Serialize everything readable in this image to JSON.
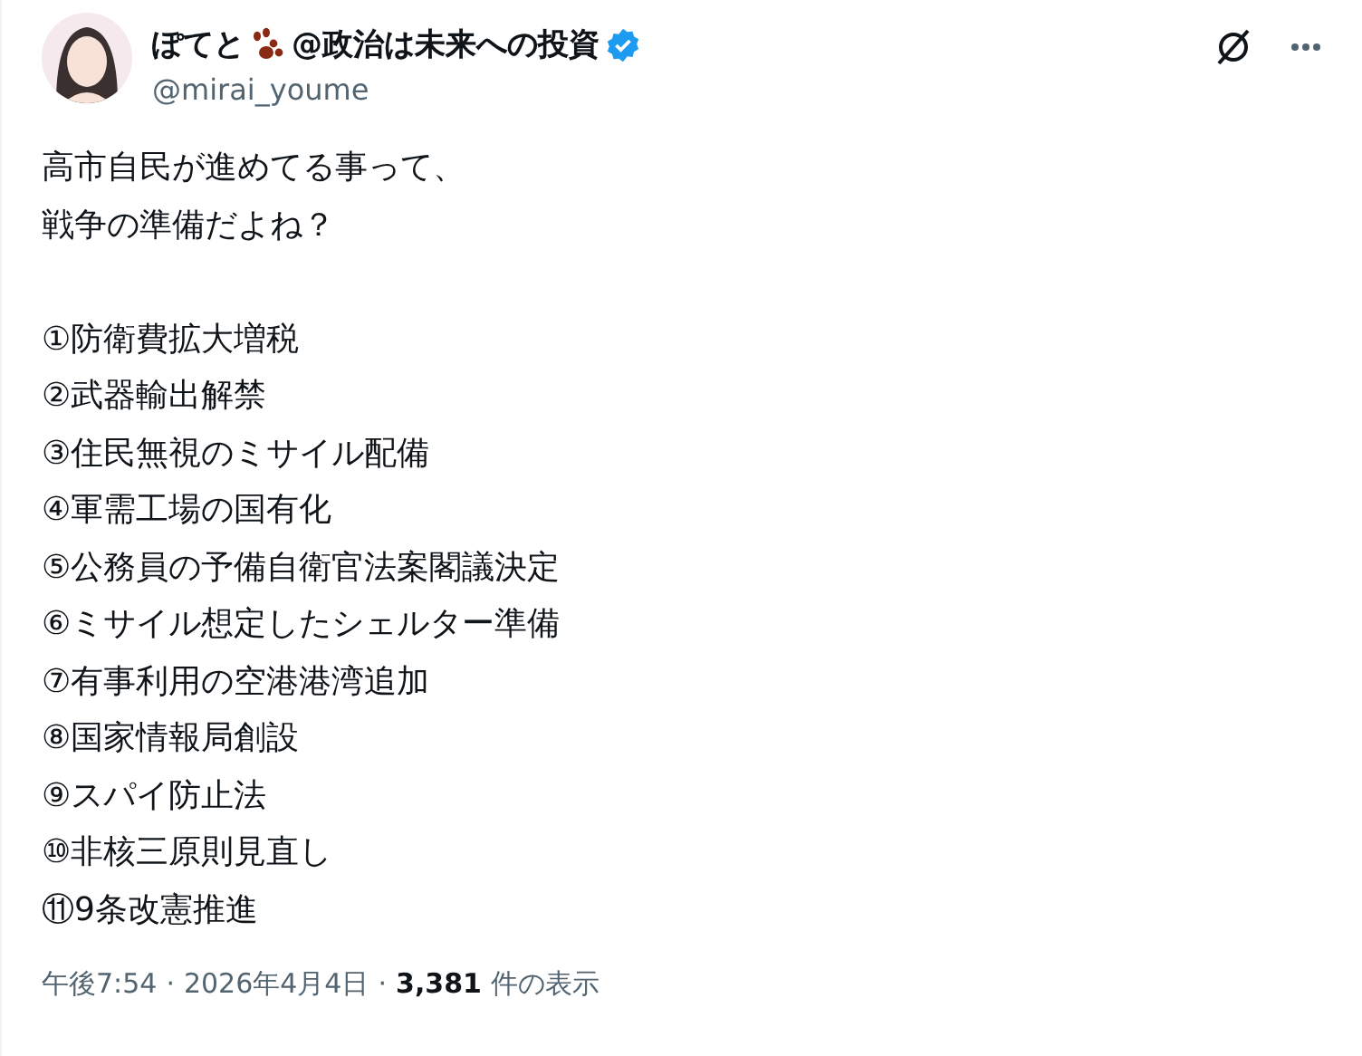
{
  "author": {
    "name_before": "ぽてと",
    "name_after": "@政治は未来への投資",
    "verified": true,
    "handle": "@mirai_youme"
  },
  "paragraphs": [
    [
      "高市自民が進めてる事って、",
      "戦争の準備だよね？"
    ],
    [
      "①防衛費拡大増税",
      "②武器輸出解禁",
      "③住民無視のミサイル配備",
      "④軍需工場の国有化",
      "⑤公務員の予備自衛官法案閣議決定",
      "⑥ミサイル想定したシェルター準備",
      "⑦有事利用の空港港湾追加",
      "⑧国家情報局創設",
      "⑨スパイ防止法",
      "⑩非核三原則見直し",
      "⑪9条改憲推進"
    ]
  ],
  "footer": [
    {
      "kind": "time",
      "text": "午後7:54"
    },
    {
      "kind": "separator",
      "text": "·"
    },
    {
      "kind": "date",
      "text": "2026年4月4日"
    },
    {
      "kind": "separator",
      "text": "·"
    },
    {
      "kind": "count",
      "text": "3,381"
    },
    {
      "kind": "label",
      "text": "件の表示"
    }
  ]
}
